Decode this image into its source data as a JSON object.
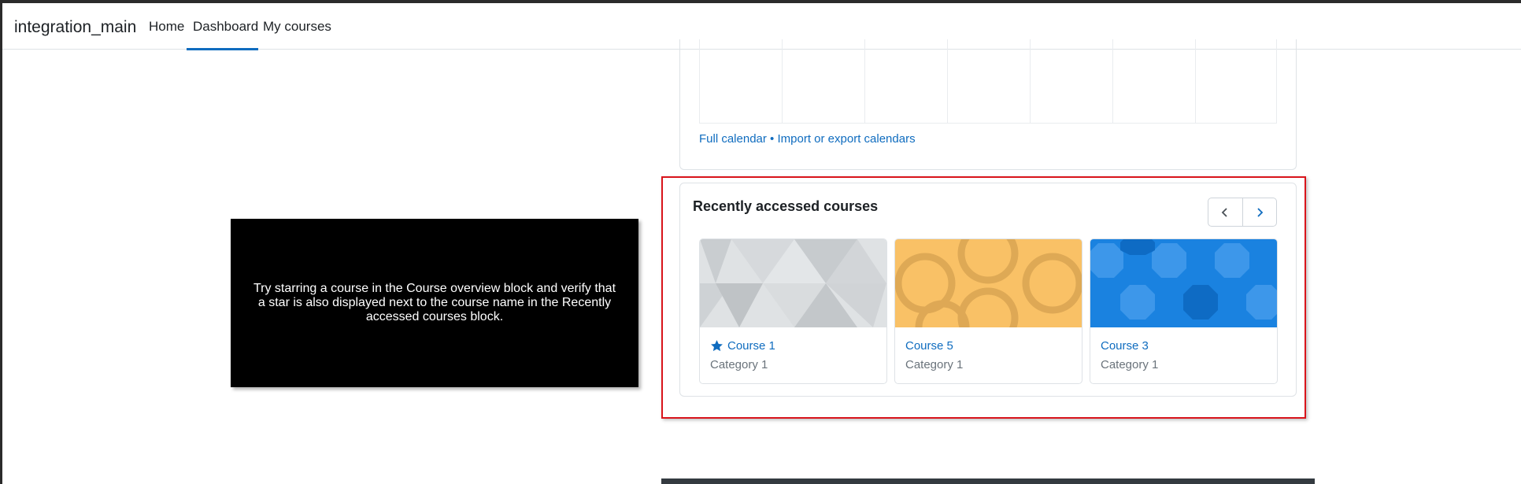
{
  "navbar": {
    "brand": "integration_main",
    "items": [
      {
        "label": "Home"
      },
      {
        "label": "Dashboard",
        "active": true
      },
      {
        "label": "My courses"
      }
    ],
    "accent_color": "#0f6cbf"
  },
  "calendar": {
    "full_calendar_link": "Full calendar",
    "separator": " • ",
    "import_export_link": "Import or export calendars"
  },
  "recent_courses": {
    "title": "Recently accessed courses",
    "prev_icon": "chevron-left-icon",
    "next_icon": "chevron-right-icon",
    "courses": [
      {
        "name": "Course 1",
        "category": "Category 1",
        "starred": true,
        "pattern": "grey-triangles"
      },
      {
        "name": "Course 5",
        "category": "Category 1",
        "starred": false,
        "pattern": "orange-circles"
      },
      {
        "name": "Course 3",
        "category": "Category 1",
        "starred": false,
        "pattern": "blue-octagons"
      }
    ],
    "highlight_color": "#d9141b"
  },
  "tour": {
    "message": "Try starring a course in the Course overview block and verify that a star is also displayed next to the course name in the Recently accessed courses block."
  }
}
